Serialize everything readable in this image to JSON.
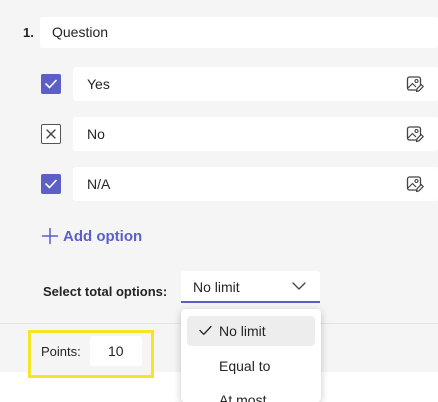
{
  "question": {
    "number": "1.",
    "title": "Question"
  },
  "options": [
    {
      "label": "Yes",
      "state": "checked"
    },
    {
      "label": "No",
      "state": "unchecked"
    },
    {
      "label": "N/A",
      "state": "checked"
    }
  ],
  "add_option_label": "Add option",
  "select_total": {
    "label": "Select total options:",
    "value": "No limit"
  },
  "points": {
    "label": "Points:",
    "value": "10"
  },
  "dropdown": {
    "items": [
      "No limit",
      "Equal to",
      "At most"
    ],
    "selected_index": 0
  },
  "colors": {
    "accent": "#5b5fc7",
    "highlight": "#f5e625",
    "panel": "#f5f5f5"
  },
  "icons": {
    "checked": "checkmark-icon",
    "unchecked": "x-mark-icon",
    "image": "image-edit-icon",
    "add": "plus-icon",
    "dropdown": "chevron-down-icon"
  }
}
